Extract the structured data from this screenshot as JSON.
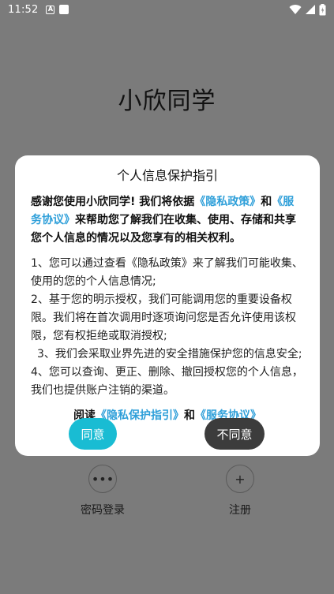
{
  "status_bar": {
    "time": "11:52",
    "icons": [
      "a-badge-icon",
      "square-notification-icon",
      "wifi-icon",
      "signal-icon",
      "battery-icon"
    ]
  },
  "app": {
    "title": "小欣同学"
  },
  "login_options": {
    "password_label": "密码登录",
    "register_label": "注册",
    "password_icon": "•••",
    "register_icon": "+"
  },
  "dialog": {
    "title": "个人信息保护指引",
    "intro_prefix": "感谢您使用小欣同学! 我们将依据",
    "privacy_link": "《隐私政策》",
    "intro_and": "和",
    "service_link": "《服务协议》",
    "intro_suffix": "来帮助您了解我们在收集、使用、存储和共享您个人信息的情况以及您享有的相关权利。",
    "items": [
      "1、您可以通过查看《隐私政策》来了解我们可能收集、使用的您的个人信息情况;",
      "2、基于您的明示授权，我们可能调用您的重要设备权限。我们将在首次调用时逐项询问您是否允许使用该权限，您有权拒绝或取消授权;",
      "3、我们会采取业界先进的安全措施保护您的信息安全;",
      "4、您可以查询、更正、删除、撤回授权您的个人信息，我们也提供账户注销的渠道。"
    ],
    "read_prefix": "阅读",
    "read_privacy_link": "《隐私保护指引》",
    "read_and": "和",
    "read_service_link": "《服务协议》",
    "agree_label": "同意",
    "disagree_label": "不同意"
  },
  "colors": {
    "overlay": "#7b7b7b",
    "link": "#2e9fd9",
    "agree": "#19bcd3",
    "disagree": "#3c3c3c"
  }
}
